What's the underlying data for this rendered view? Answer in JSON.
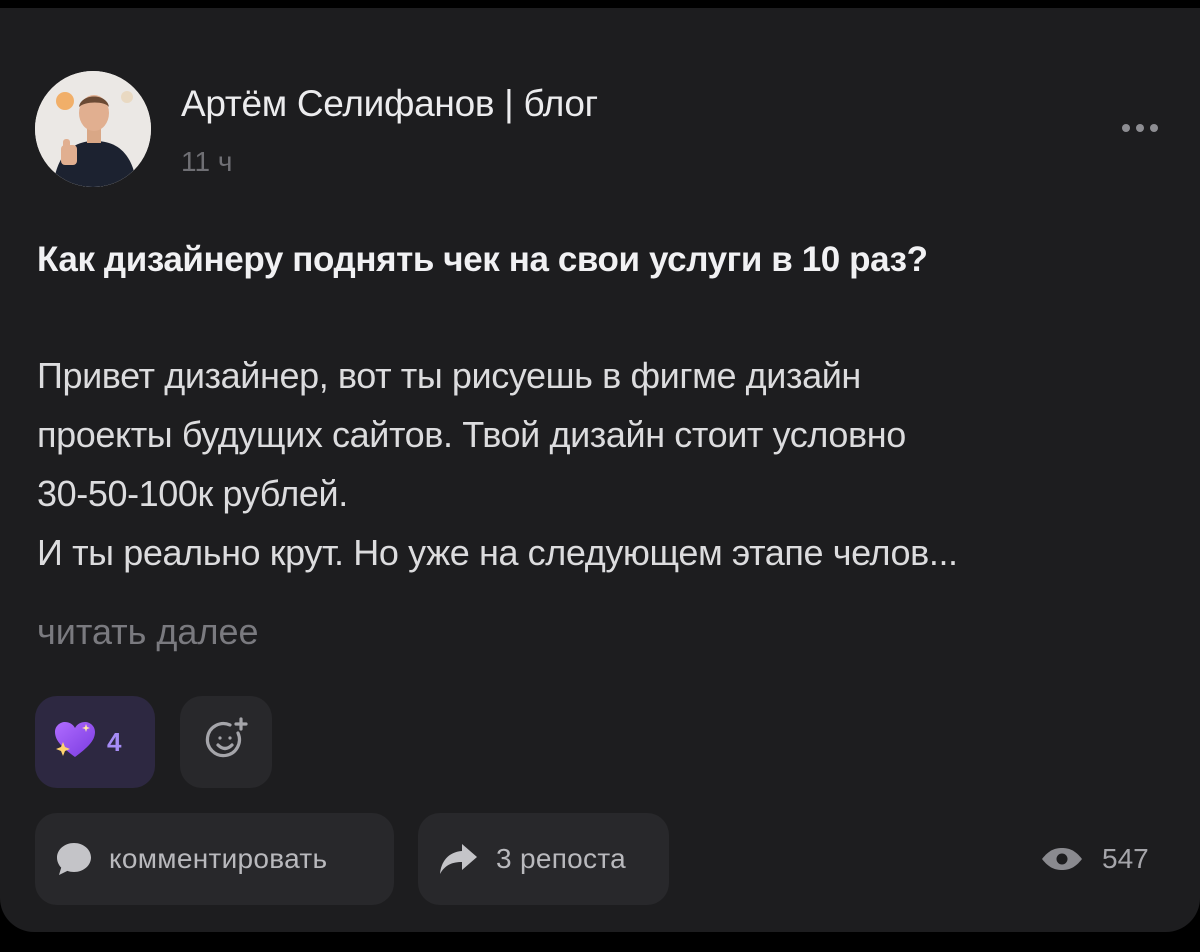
{
  "post": {
    "author": "Артём Селифанов | блог",
    "time": "11 ч",
    "title": "Как дизайнеру поднять чек на свои услуги в 10 раз?",
    "body_lines": [
      "Привет дизайнер, вот ты рисуешь в фигме дизайн",
      "проекты будущих сайтов. Твой дизайн стоит условно",
      "30-50-100к рублей.",
      "И ты реально крут. Но уже на следующем этапе челов..."
    ],
    "read_more": "читать далее"
  },
  "reactions": {
    "icon": "sparkle-heart-icon",
    "count": "4",
    "add_icon": "add-reaction-icon"
  },
  "actions": {
    "comment_label": "комментировать",
    "comment_icon": "comment-bubble-icon",
    "repost_label": "3 репоста",
    "repost_icon": "repost-arrow-icon"
  },
  "stats": {
    "views": "547",
    "views_icon": "eye-icon"
  },
  "colors": {
    "card_background": "#1d1d1f",
    "reaction_accent": "#a68cf6",
    "heart": "#8b4cf0"
  }
}
